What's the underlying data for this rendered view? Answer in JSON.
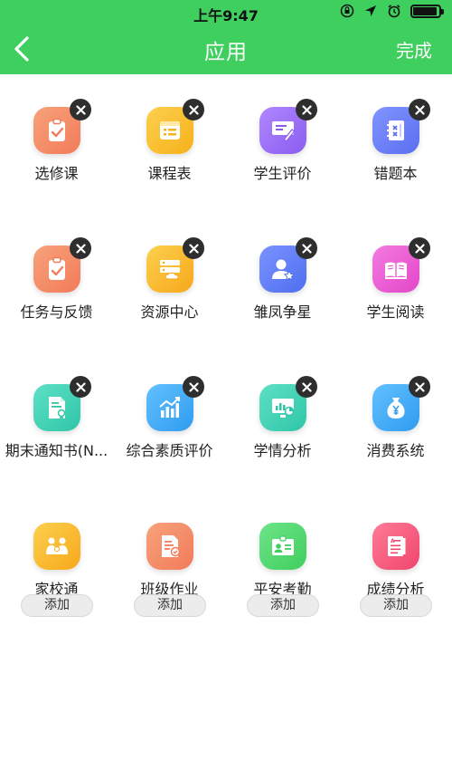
{
  "status_bar": {
    "time": "上午9:47"
  },
  "nav": {
    "title": "应用",
    "done_label": "完成"
  },
  "apps": [
    {
      "label": "选修课",
      "icon": "clipboard-check-icon",
      "color": "#f27b5b",
      "color2": "#f7a27a"
    },
    {
      "label": "课程表",
      "icon": "timetable-icon",
      "color": "#f7b11a",
      "color2": "#fcd04e"
    },
    {
      "label": "学生评价",
      "icon": "evaluation-icon",
      "color": "#8a5cf0",
      "color2": "#b088ff"
    },
    {
      "label": "错题本",
      "icon": "notebook-icon",
      "color": "#5a6ff0",
      "color2": "#8294ff"
    },
    {
      "label": "任务与反馈",
      "icon": "task-clipboard-icon",
      "color": "#f27b5b",
      "color2": "#f7a27a"
    },
    {
      "label": "资源中心",
      "icon": "server-cloud-icon",
      "color": "#f7a81a",
      "color2": "#fcd04e"
    },
    {
      "label": "雏凤争星",
      "icon": "user-star-icon",
      "color": "#4f6ef0",
      "color2": "#7a93ff"
    },
    {
      "label": "学生阅读",
      "icon": "open-book-icon",
      "color": "#e446c9",
      "color2": "#f27be0"
    },
    {
      "label": "期末通知书(N...",
      "icon": "certificate-icon",
      "color": "#2fc6a8",
      "color2": "#5ee0c4"
    },
    {
      "label": "综合素质评价",
      "icon": "growth-chart-icon",
      "color": "#2f9cf0",
      "color2": "#62c0ff"
    },
    {
      "label": "学情分析",
      "icon": "analysis-screen-icon",
      "color": "#2fc6a8",
      "color2": "#5ee0c4"
    },
    {
      "label": "消费系统",
      "icon": "money-bag-icon",
      "color": "#2f9cf0",
      "color2": "#62c0ff"
    }
  ],
  "more_apps": [
    {
      "label": "家校通",
      "icon": "family-icon",
      "color": "#f7a81a",
      "color2": "#fcd04e",
      "add_label": "添加"
    },
    {
      "label": "班级作业",
      "icon": "homework-icon",
      "color": "#f27b5b",
      "color2": "#f7a27a",
      "add_label": "添加"
    },
    {
      "label": "平安考勤",
      "icon": "id-card-icon",
      "color": "#3fcf5e",
      "color2": "#6ee388",
      "add_label": "添加"
    },
    {
      "label": "成绩分析",
      "icon": "grade-report-icon",
      "color": "#f0466e",
      "color2": "#ff7a96",
      "add_label": "添加"
    }
  ],
  "colors": {
    "accent": "#3fcf5e",
    "remove_badge": "#2e2e2e"
  }
}
